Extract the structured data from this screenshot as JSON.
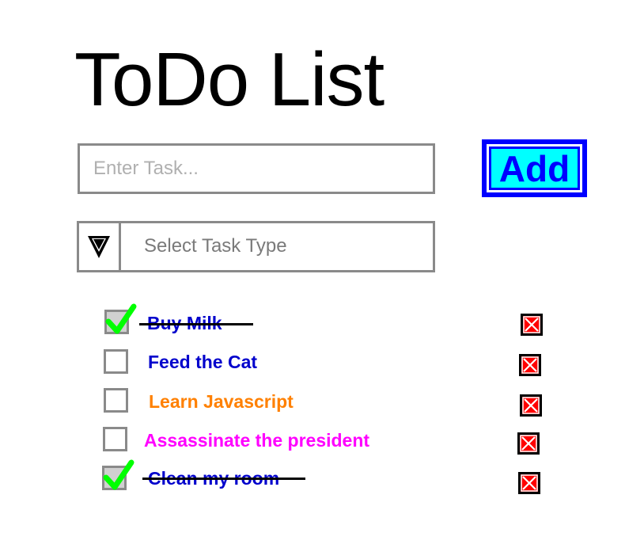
{
  "app": {
    "title": "ToDo List"
  },
  "task_input": {
    "placeholder": "Enter Task...",
    "value": ""
  },
  "add_button": {
    "label": "Add",
    "colors": {
      "background": "#00ffff",
      "border": "#0000ff",
      "text": "#0000ff"
    }
  },
  "task_type_select": {
    "label": "Select Task Type",
    "icon": "triangle-down-icon"
  },
  "tasks": [
    {
      "label": "Buy Milk",
      "completed": true,
      "color": "#0000cc"
    },
    {
      "label": "Feed the Cat",
      "completed": false,
      "color": "#0000cc"
    },
    {
      "label": "Learn Javascript",
      "completed": false,
      "color": "#ff8000"
    },
    {
      "label": "Assassinate the president",
      "completed": false,
      "color": "#ff00ff"
    },
    {
      "label": "Clean my room",
      "completed": true,
      "color": "#0000cc"
    }
  ],
  "icons": {
    "check": "check-icon",
    "delete": "close-icon"
  },
  "colors": {
    "check_mark": "#00ff00",
    "delete_background": "#ff0000"
  }
}
